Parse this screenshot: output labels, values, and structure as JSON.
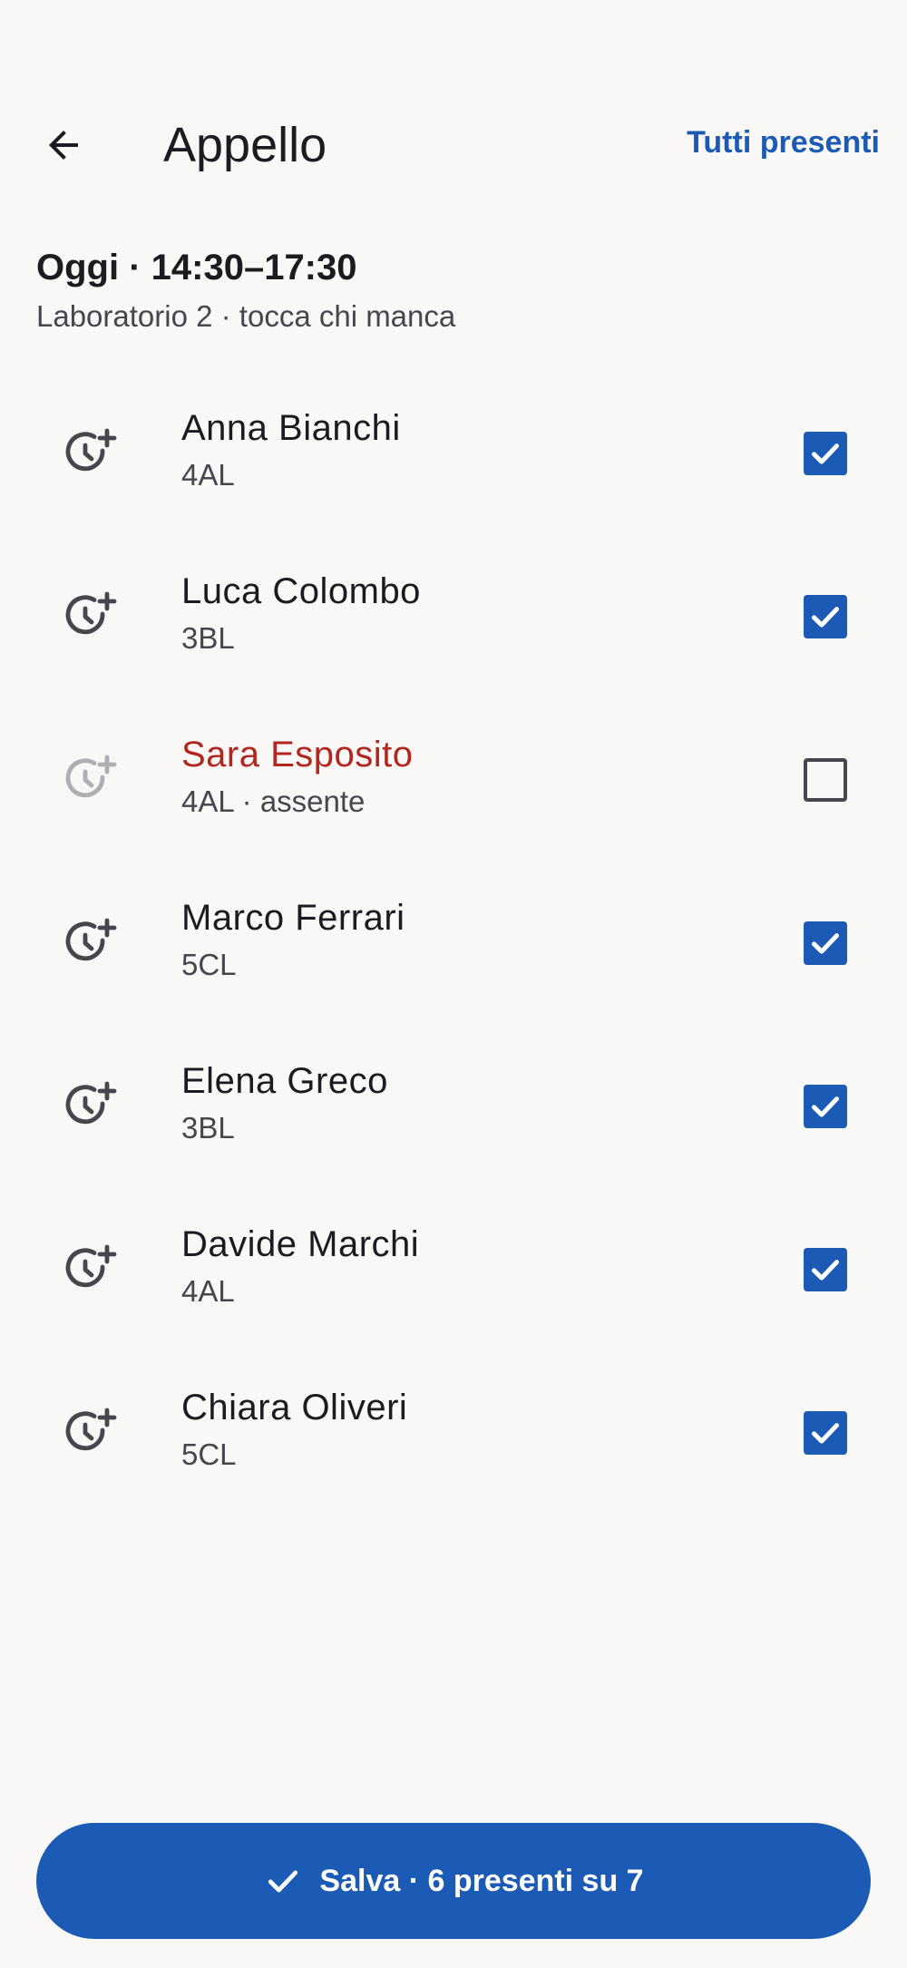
{
  "header": {
    "title": "Appello",
    "all_present_label": "Tutti presenti"
  },
  "session": {
    "title": "Oggi · 14:30–17:30",
    "subtitle": "Laboratorio 2 · tocca chi manca"
  },
  "students": [
    {
      "name": "Anna Bianchi",
      "meta": "4AL",
      "present": true
    },
    {
      "name": "Luca Colombo",
      "meta": "3BL",
      "present": true
    },
    {
      "name": "Sara Esposito",
      "meta": "4AL · assente",
      "present": false
    },
    {
      "name": "Marco Ferrari",
      "meta": "5CL",
      "present": true
    },
    {
      "name": "Elena Greco",
      "meta": "3BL",
      "present": true
    },
    {
      "name": "Davide Marchi",
      "meta": "4AL",
      "present": true
    },
    {
      "name": "Chiara Oliveri",
      "meta": "5CL",
      "present": true
    }
  ],
  "footer": {
    "save_label": "Salva · 6 presenti su 7"
  },
  "icons": {
    "back": "arrow-back-icon",
    "row": "clock-plus-icon",
    "check": "check-icon"
  },
  "colors": {
    "accent": "#1c5bb5",
    "absent": "#b3261e",
    "background": "#f9f8f7"
  }
}
